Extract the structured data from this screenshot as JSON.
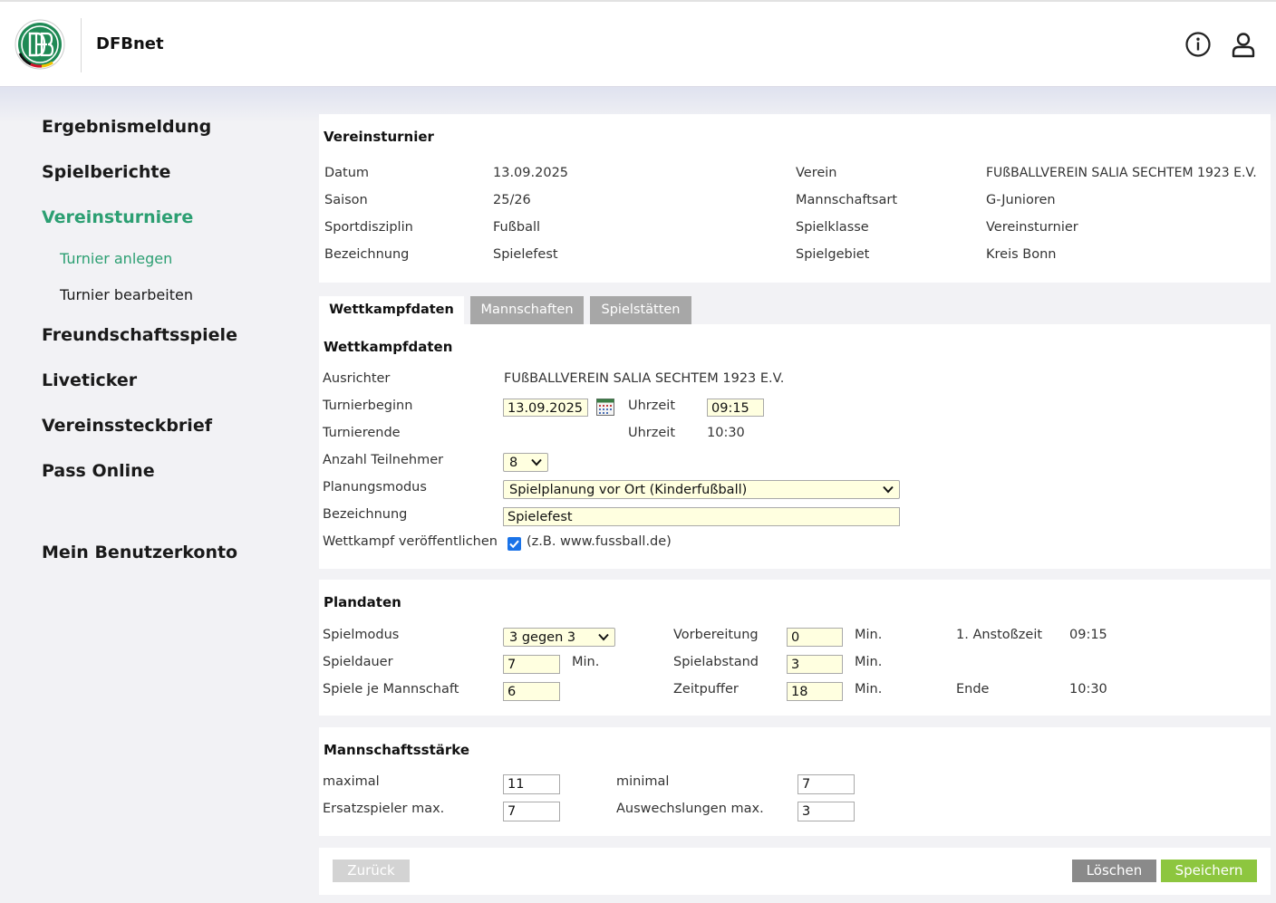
{
  "header": {
    "app_title": "DFBnet",
    "info_icon": "info-icon",
    "user_icon": "user-icon",
    "logo_text": "DFB"
  },
  "nav": {
    "items": [
      "Ergebnismeldung",
      "Spielberichte",
      "Vereinsturniere",
      "Freundschaftsspiele",
      "Liveticker",
      "Vereinssteckbrief",
      "Pass Online"
    ],
    "active": "Vereinsturniere",
    "sub_items": [
      "Turnier anlegen",
      "Turnier bearbeiten"
    ],
    "active_sub": "Turnier anlegen",
    "account": "Mein Benutzerkonto"
  },
  "info": {
    "title": "Vereinsturnier",
    "left": [
      {
        "label": "Datum",
        "value": "13.09.2025"
      },
      {
        "label": "Saison",
        "value": "25/26"
      },
      {
        "label": "Sportdisziplin",
        "value": "Fußball"
      },
      {
        "label": "Bezeichnung",
        "value": "Spielefest"
      }
    ],
    "right": [
      {
        "label": "Verein",
        "value": "FUßBALLVEREIN SALIA SECHTEM 1923 E.V."
      },
      {
        "label": "Mannschaftsart",
        "value": "G-Junioren"
      },
      {
        "label": "Spielklasse",
        "value": "Vereinsturnier"
      },
      {
        "label": "Spielgebiet",
        "value": "Kreis Bonn"
      }
    ]
  },
  "tabs": [
    "Wettkampfdaten",
    "Mannschaften",
    "Spielstätten"
  ],
  "wettkampf": {
    "title": "Wettkampfdaten",
    "ausrichter_label": "Ausrichter",
    "ausrichter_value": "FUßBALLVEREIN SALIA SECHTEM 1923 E.V.",
    "beginn_label": "Turnierbeginn",
    "beginn_date": "13.09.2025",
    "uhrzeit_label": "Uhrzeit",
    "beginn_time": "09:15",
    "ende_label": "Turnierende",
    "ende_time": "10:30",
    "teilnehmer_label": "Anzahl Teilnehmer",
    "teilnehmer_value": "8",
    "planung_label": "Planungsmodus",
    "planung_value": "Spielplanung vor Ort (Kinderfußball)",
    "bezeichnung_label": "Bezeichnung",
    "bezeichnung_value": "Spielefest",
    "publish_label": "Wettkampf veröffentlichen",
    "publish_checked": true,
    "publish_hint": "(z.B. www.fussball.de)"
  },
  "plan": {
    "title": "Plandaten",
    "spielmodus_label": "Spielmodus",
    "spielmodus_value": "3 gegen 3",
    "spieldauer_label": "Spieldauer",
    "spieldauer_value": "7",
    "spiele_label": "Spiele je Mannschaft",
    "spiele_value": "6",
    "vorbereitung_label": "Vorbereitung",
    "vorbereitung_value": "0",
    "abstand_label": "Spielabstand",
    "abstand_value": "3",
    "puffer_label": "Zeitpuffer",
    "puffer_value": "18",
    "min_unit": "Min.",
    "anstoss_label": "1. Anstoßzeit",
    "anstoss_value": "09:15",
    "ende_label": "Ende",
    "ende_value": "10:30"
  },
  "staerke": {
    "title": "Mannschaftsstärke",
    "max_label": "maximal",
    "max_value": "11",
    "min_label": "minimal",
    "min_value": "7",
    "ersatz_label": "Ersatzspieler max.",
    "ersatz_value": "7",
    "wechsel_label": "Auswechslungen max.",
    "wechsel_value": "3"
  },
  "buttons": {
    "back": "Zurück",
    "delete": "Löschen",
    "save": "Speichern"
  },
  "colors": {
    "accent_green": "#2c9f72",
    "save_green": "#8dc63f",
    "delete_grey": "#8a8a8a",
    "back_grey": "#d3d3d3"
  }
}
